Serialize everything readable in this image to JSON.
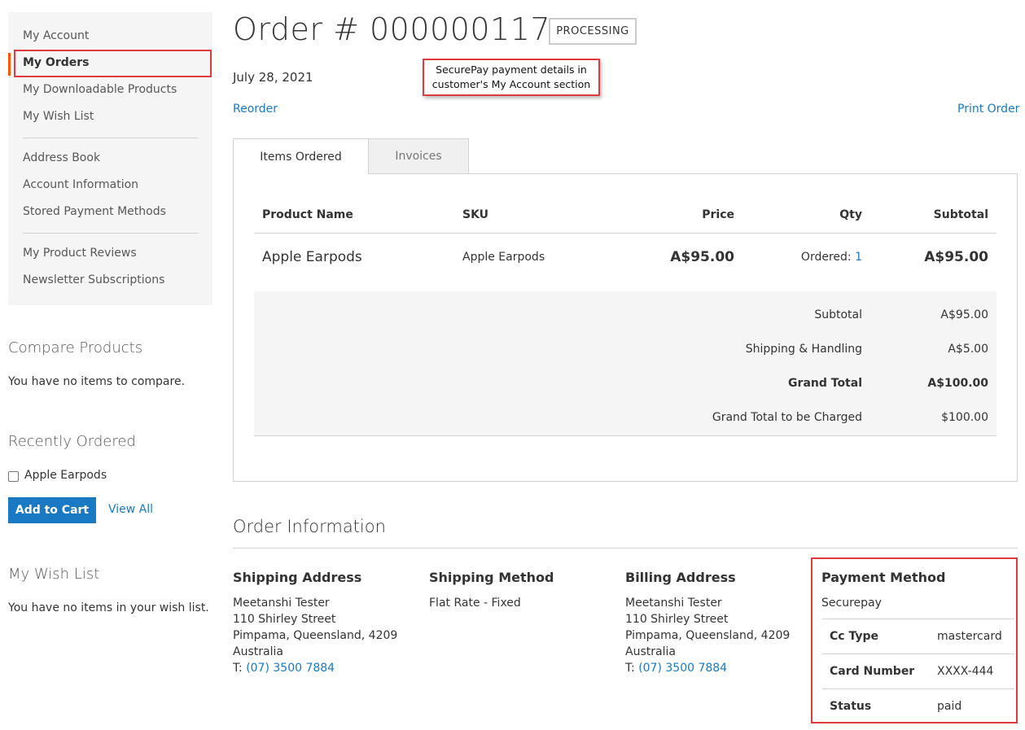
{
  "sidebar": {
    "nav": [
      {
        "label": "My Account"
      },
      {
        "label": "My Orders",
        "current": true
      },
      {
        "label": "My Downloadable Products"
      },
      {
        "label": "My Wish List"
      },
      {
        "label": "Address Book"
      },
      {
        "label": "Account Information"
      },
      {
        "label": "Stored Payment Methods"
      },
      {
        "label": "My Product Reviews"
      },
      {
        "label": "Newsletter Subscriptions"
      }
    ],
    "compare": {
      "title": "Compare Products",
      "empty_text": "You have no items to compare."
    },
    "recently_ordered": {
      "title": "Recently Ordered",
      "item": "Apple Earpods",
      "add_to_cart": "Add to Cart",
      "view_all": "View All"
    },
    "wishlist": {
      "title": "My Wish List",
      "empty_text": "You have no items in your wish list."
    }
  },
  "order": {
    "title": "Order # 000000117",
    "status": "PROCESSING",
    "date": "July 28, 2021",
    "reorder": "Reorder",
    "print": "Print Order",
    "callout": "SecurePay payment details in customer's My Account section"
  },
  "tabs": [
    {
      "label": "Items Ordered",
      "active": true
    },
    {
      "label": "Invoices",
      "active": false
    }
  ],
  "items_table": {
    "headers": {
      "name": "Product Name",
      "sku": "SKU",
      "price": "Price",
      "qty": "Qty",
      "subtotal": "Subtotal"
    },
    "rows": [
      {
        "name": "Apple Earpods",
        "sku": "Apple Earpods",
        "price": "A$95.00",
        "qty_label": "Ordered:",
        "qty_value": "1",
        "subtotal": "A$95.00"
      }
    ]
  },
  "totals": [
    {
      "label": "Subtotal",
      "value": "A$95.00"
    },
    {
      "label": "Shipping & Handling",
      "value": "A$5.00"
    },
    {
      "label": "Grand Total",
      "value": "A$100.00",
      "strong": true
    },
    {
      "label": "Grand Total to be Charged",
      "value": "$100.00"
    }
  ],
  "order_info": {
    "title": "Order Information",
    "shipping_address": {
      "title": "Shipping Address",
      "lines": [
        "Meetanshi Tester",
        "110 Shirley Street",
        "Pimpama, Queensland, 4209",
        "Australia"
      ],
      "phone_prefix": "T:",
      "phone": "(07) 3500 7884"
    },
    "shipping_method": {
      "title": "Shipping Method",
      "value": "Flat Rate - Fixed"
    },
    "billing_address": {
      "title": "Billing Address",
      "lines": [
        "Meetanshi Tester",
        "110 Shirley Street",
        "Pimpama, Queensland, 4209",
        "Australia"
      ],
      "phone_prefix": "T:",
      "phone": "(07) 3500 7884"
    },
    "payment_method": {
      "title": "Payment Method",
      "name": "Securepay",
      "rows": [
        {
          "label": "Cc Type",
          "value": "mastercard"
        },
        {
          "label": "Card Number",
          "value": "XXXX-444"
        },
        {
          "label": "Status",
          "value": "paid"
        }
      ]
    }
  },
  "colors": {
    "link": "#1979c3",
    "highlight": "#e0393e",
    "nav_current": "#ff5501",
    "button": "#1979c3"
  }
}
